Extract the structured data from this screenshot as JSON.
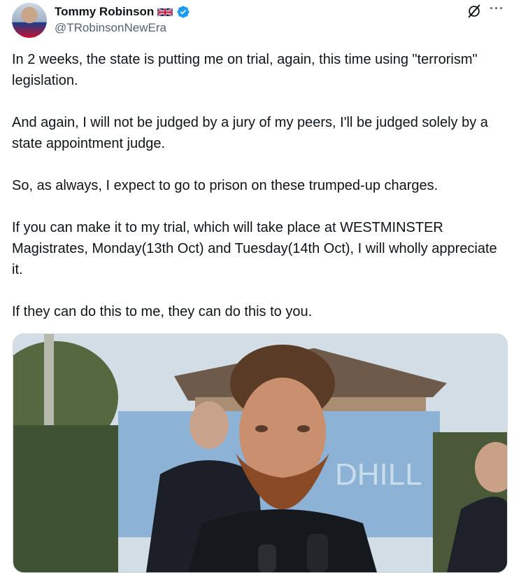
{
  "author": {
    "display_name": "Tommy Robinson",
    "handle": "@TRobinsonNewEra",
    "flag_icon": "uk-flag-icon",
    "verified_icon": "verified-badge-icon"
  },
  "header_actions": {
    "grok_icon": "grok-icon",
    "more_icon": "more-icon",
    "more_label": "···"
  },
  "tweet": {
    "text": "In 2 weeks, the state is putting me on trial, again, this time using \"terrorism\" legislation.\n\nAnd again, I will not be judged by a jury of my peers, I'll be judged solely by a state appointment judge.\n\nSo, as always, I expect to go to prison on these trumped-up charges.\n\nIf you can make it to my trial, which will take place at WESTMINSTER Magistrates, Monday(13th Oct) and Tuesday(14th Oct), I will wholly appreciate it.\n\nIf they can do this to me, they can do this to you."
  },
  "media": {
    "sign_text": "DHILL"
  },
  "colors": {
    "text": "#0f1419",
    "secondary": "#536471",
    "verified_blue": "#1d9bf0",
    "border": "#cfd9de"
  }
}
